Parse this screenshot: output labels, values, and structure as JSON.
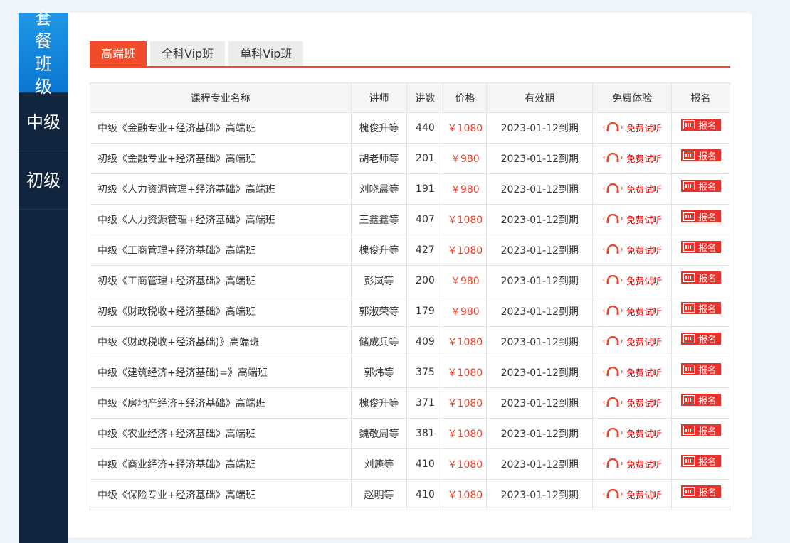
{
  "sidebar": {
    "items": [
      {
        "label": "套餐班级",
        "active": true
      },
      {
        "label": "中级",
        "active": false
      },
      {
        "label": "初级",
        "active": false
      }
    ]
  },
  "tabs": [
    {
      "label": "高端班",
      "active": true
    },
    {
      "label": "全科Vip班",
      "active": false
    },
    {
      "label": "单科Vip班",
      "active": false
    }
  ],
  "table": {
    "headers": [
      "课程专业名称",
      "讲师",
      "讲数",
      "价格",
      "有效期",
      "免费体验",
      "报名"
    ],
    "trial_label": "免费试听",
    "signup_label": "报名",
    "rows": [
      {
        "name": "中级《金融专业+经济基础》高端班",
        "teacher": "槐俊升等",
        "lectures": "440",
        "price": "￥1080",
        "expiry": "2023-01-12到期"
      },
      {
        "name": "初级《金融专业+经济基础》高端班",
        "teacher": "胡老师等",
        "lectures": "201",
        "price": "￥980",
        "expiry": "2023-01-12到期"
      },
      {
        "name": "初级《人力资源管理+经济基础》高端班",
        "teacher": "刘晓晨等",
        "lectures": "191",
        "price": "￥980",
        "expiry": "2023-01-12到期"
      },
      {
        "name": "中级《人力资源管理+经济基础》高端班",
        "teacher": "王鑫鑫等",
        "lectures": "407",
        "price": "￥1080",
        "expiry": "2023-01-12到期"
      },
      {
        "name": "中级《工商管理+经济基础》高端班",
        "teacher": "槐俊升等",
        "lectures": "427",
        "price": "￥1080",
        "expiry": "2023-01-12到期"
      },
      {
        "name": "初级《工商管理+经济基础》高端班",
        "teacher": "彭岚等",
        "lectures": "200",
        "price": "￥980",
        "expiry": "2023-01-12到期"
      },
      {
        "name": "初级《财政税收+经济基础》高端班",
        "teacher": "郭淑荣等",
        "lectures": "179",
        "price": "￥980",
        "expiry": "2023-01-12到期"
      },
      {
        "name": "中级《财政税收+经济基础)》高端班",
        "teacher": "储成兵等",
        "lectures": "409",
        "price": "￥1080",
        "expiry": "2023-01-12到期"
      },
      {
        "name": "中级《建筑经济+经济基础)=》高端班",
        "teacher": "郭炜等",
        "lectures": "375",
        "price": "￥1080",
        "expiry": "2023-01-12到期"
      },
      {
        "name": "中级《房地产经济+经济基础》高端班",
        "teacher": "槐俊升等",
        "lectures": "371",
        "price": "￥1080",
        "expiry": "2023-01-12到期"
      },
      {
        "name": "中级《农业经济+经济基础》高端班",
        "teacher": "魏敬周等",
        "lectures": "381",
        "price": "￥1080",
        "expiry": "2023-01-12到期"
      },
      {
        "name": "中级《商业经济+经济基础》高端班",
        "teacher": "刘篪等",
        "lectures": "410",
        "price": "￥1080",
        "expiry": "2023-01-12到期"
      },
      {
        "name": "中级《保险专业+经济基础》高端班",
        "teacher": "赵明等",
        "lectures": "410",
        "price": "￥1080",
        "expiry": "2023-01-12到期"
      }
    ]
  },
  "colors": {
    "accent": "#f04c2c",
    "sidebar_bg": "#11253f",
    "sidebar_active": "#0a76d0",
    "price": "#e8452c"
  }
}
